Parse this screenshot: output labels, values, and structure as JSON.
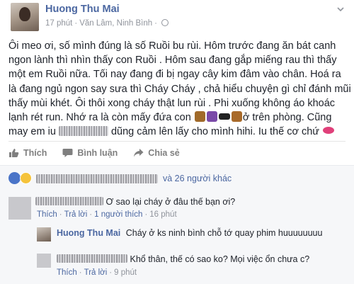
{
  "post": {
    "author": "Huong Thu Mai",
    "time": "17 phút",
    "location": "Văn Lâm, Ninh Bình",
    "lines": [
      "Ôi meo ơi, số mình đúng là số Ruồi bu rùi. Hôm trước đang ăn bát canh",
      "ngon lành thì nhìn thấy con Ruồi . Hôm sau đang gắp miếng rau thì thấy",
      "một em Ruồi nữa. Tối nay đang đi bị ngay cây kim đâm vào chân. Hoá ra",
      "là đang ngủ ngon say sưa thì Cháy Cháy , chả hiểu chuyện gì chỉ đánh mũi",
      "thấy mùi khét. Ôi thôi xong cháy thật lun rùi . Phi xuống không áo khoác",
      "lạnh rét run. Nhớ ra là còn mấy đứa con",
      "ở trên phòng. Cũng",
      "may em iu",
      "dũng cảm lên lấy cho mình hihi. Iu thế cơ chứ"
    ]
  },
  "actions": {
    "like": "Thích",
    "comment": "Bình luận",
    "share": "Chia sẻ"
  },
  "reactions": {
    "others": "và 26 người khác"
  },
  "comments": [
    {
      "text": "Ơ sao lại cháy ở đâu thế bạn ơi?",
      "like": "Thích",
      "reply": "Trả lời",
      "likes": "1 người thích",
      "time": "16 phút"
    },
    {
      "author": "Huong Thu Mai",
      "text": "Cháy ở ks ninh bình chỗ tớ quay phim huuuuuuuu"
    },
    {
      "text": "Khổ thân, thế có sao ko? Mọi việc ổn chưa c?",
      "like": "Thích",
      "reply": "Trả lời",
      "time": "9 phút"
    }
  ],
  "colors": {
    "link": "#4b67a1",
    "meta": "#90949c",
    "text": "#1d2129",
    "comment_bg": "#f6f7f9"
  }
}
